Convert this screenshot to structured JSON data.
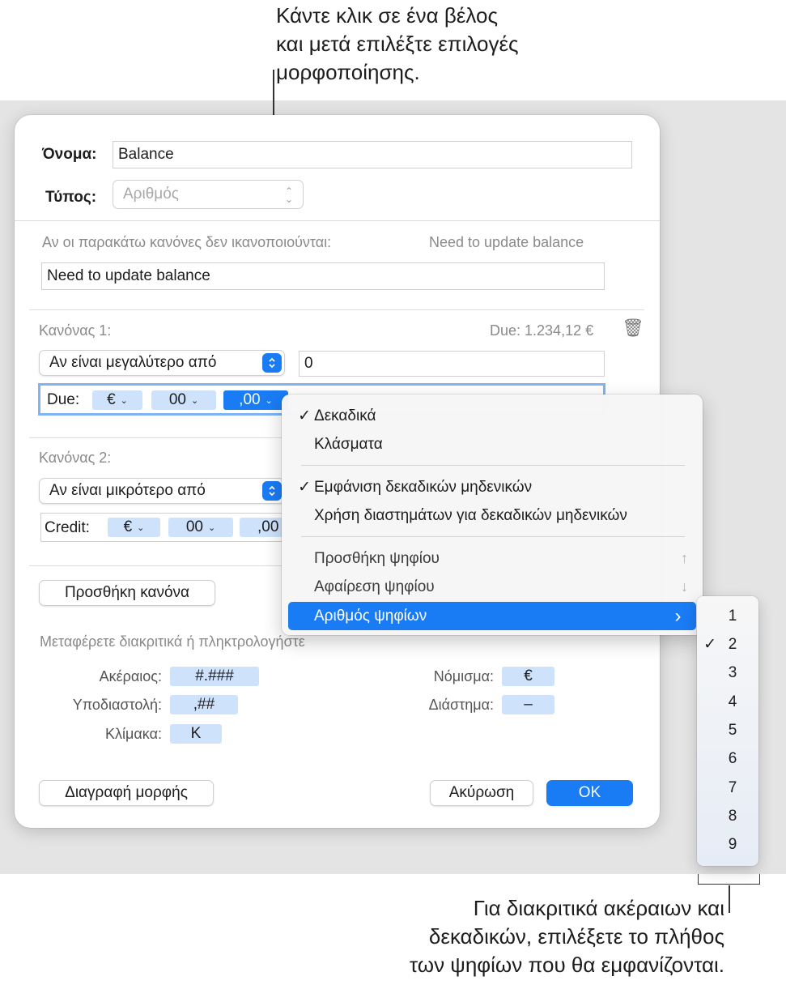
{
  "callouts": {
    "top": "Κάντε κλικ σε ένα βέλος\nκαι μετά επιλέξτε επιλογές\nμορφοποίησης.",
    "bottom": "Για διακριτικά ακέραιων και\nδεκαδικών, επιλέξετε το πλήθος\nτων ψηφίων που θα εμφανίζονται."
  },
  "form": {
    "name_label": "Όνομα:",
    "name_value": "Balance",
    "type_label": "Τύπος:",
    "type_value": "Αριθμός",
    "unmet_label": "Αν οι παρακάτω κανόνες δεν ικανοποιούνται:",
    "unmet_preview": "Need to update balance",
    "unmet_value": "Need to update balance"
  },
  "rule1": {
    "title": "Κανόνας 1:",
    "preview": "Due: 1.234,12 €",
    "condition": "Αν είναι μεγαλύτερο από",
    "value": "0",
    "prefix": "Due:",
    "tokens": [
      "€",
      "00",
      ",00"
    ]
  },
  "rule2": {
    "title": "Κανόνας 2:",
    "condition": "Αν είναι μικρότερο από",
    "prefix": "Credit:",
    "tokens": [
      "€",
      "00",
      ",00"
    ]
  },
  "add_rule_button": "Προσθήκη κανόνα",
  "drag_hint": "Μεταφέρετε διακριτικά ή πληκτρολογήστε κείμενο στο πεδίο από πάνω:",
  "token_palette": {
    "integer_label": "Ακέραιος:",
    "integer_token": "#.###",
    "decimal_label": "Υποδιαστολή:",
    "decimal_token": ",##",
    "scale_label": "Κλίμακα:",
    "scale_token": "K",
    "currency_label": "Νόμισμα:",
    "currency_token": "€",
    "space_label": "Διάστημα:",
    "space_token": "–"
  },
  "footer": {
    "delete_button": "Διαγραφή μορφής",
    "cancel_button": "Ακύρωση",
    "ok_button": "OK"
  },
  "menu": {
    "items": [
      {
        "label": "Δεκαδικά",
        "checked": true
      },
      {
        "label": "Κλάσματα",
        "checked": false
      },
      {
        "label": "Εμφάνιση δεκαδικών μηδενικών",
        "checked": true
      },
      {
        "label": "Χρήση διαστημάτων για δεκαδικών μηδενικών",
        "checked": false
      },
      {
        "label": "Προσθήκη ψηφίου",
        "shortcut": "↑"
      },
      {
        "label": "Αφαίρεση ψηφίου",
        "shortcut": "↓"
      },
      {
        "label": "Αριθμός ψηφίων",
        "submenu_arrow": "›"
      }
    ],
    "check_mark": "✓"
  },
  "submenu": {
    "items": [
      "1",
      "2",
      "3",
      "4",
      "5",
      "6",
      "7",
      "8",
      "9"
    ],
    "checked_index": 1
  },
  "colors": {
    "accent": "#1a7cf5",
    "token_bg": "#cfe2fb",
    "backdrop": "#e4e4e4"
  }
}
